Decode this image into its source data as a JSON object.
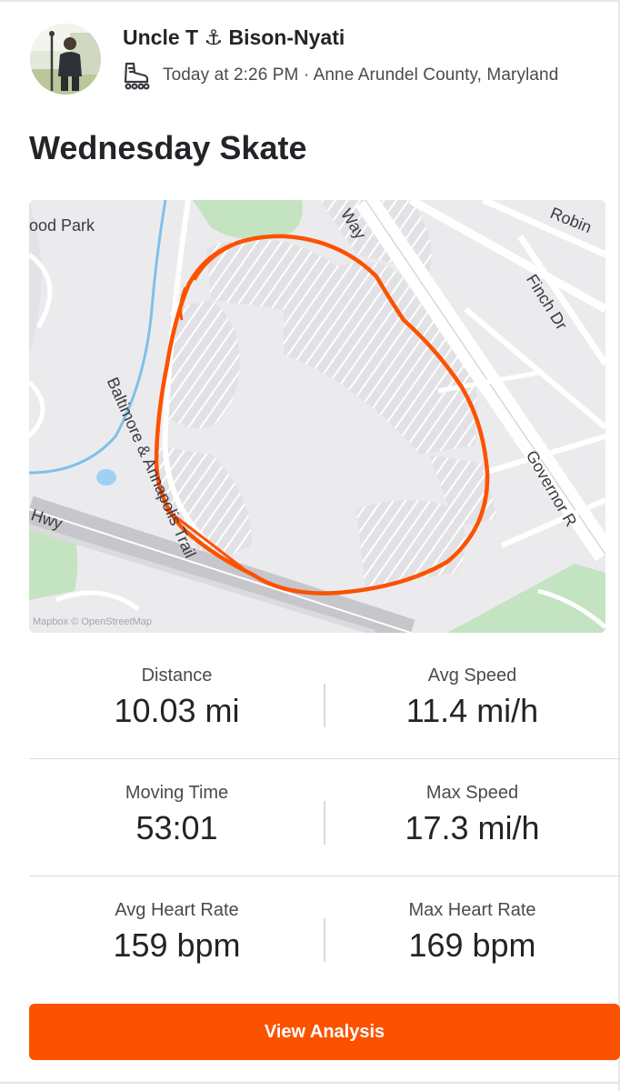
{
  "header": {
    "athlete_name": "Uncle T ⚓ Bison-Nyati",
    "meta_text": "Today at 2:26 PM · Anne Arundel County, Maryland",
    "sport_icon": "inline-skate-icon",
    "avatar": "athlete-avatar"
  },
  "activity": {
    "title": "Wednesday Skate"
  },
  "map": {
    "labels": {
      "park": "ood Park",
      "street_way": "Way",
      "street_robin": "Robin",
      "street_finch": "Finch Dr",
      "trail": "Baltimore & Annapolis Trail",
      "highway": "Hwy",
      "governor": "Governor R"
    },
    "attribution": "Mapbox © OpenStreetMap",
    "route_color": "#fc5200"
  },
  "stats": [
    {
      "left": {
        "label": "Distance",
        "value": "10.03 mi"
      },
      "right": {
        "label": "Avg Speed",
        "value": "11.4 mi/h"
      }
    },
    {
      "left": {
        "label": "Moving Time",
        "value": "53:01"
      },
      "right": {
        "label": "Max Speed",
        "value": "17.3 mi/h"
      }
    },
    {
      "left": {
        "label": "Avg Heart Rate",
        "value": "159 bpm"
      },
      "right": {
        "label": "Max Heart Rate",
        "value": "169 bpm"
      }
    }
  ],
  "actions": {
    "view_analysis_label": "View Analysis"
  },
  "colors": {
    "accent": "#fc5200",
    "text_primary": "#242428",
    "text_secondary": "#4a4a50"
  }
}
